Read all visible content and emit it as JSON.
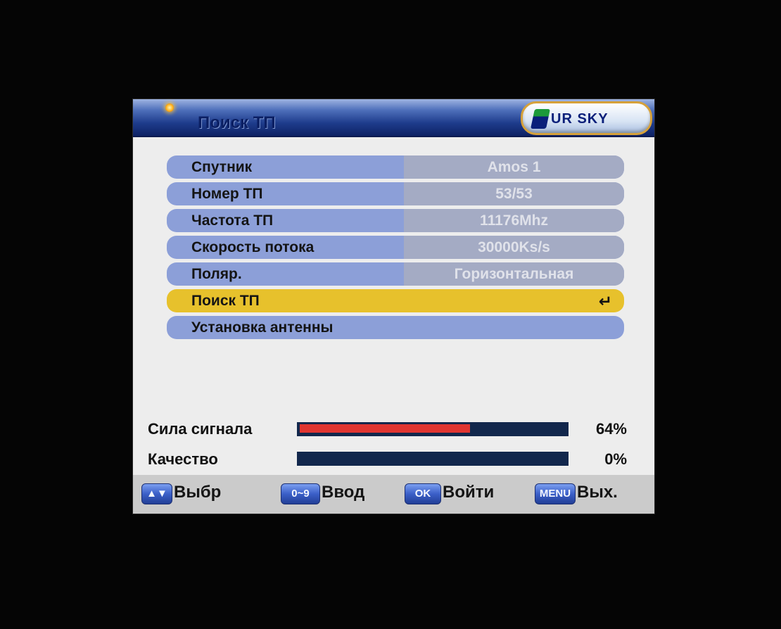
{
  "title": "Поиск ТП",
  "logo": {
    "text": "UR SKY"
  },
  "menu": [
    {
      "label": "Спутник",
      "value": "Amos 1"
    },
    {
      "label": "Номер ТП",
      "value": "53/53"
    },
    {
      "label": "Частота ТП",
      "value": "11176Mhz"
    },
    {
      "label": "Скорость потока",
      "value": "30000Ks/s"
    },
    {
      "label": "Поляр.",
      "value": "Горизонтальная"
    },
    {
      "label": "Поиск ТП",
      "enter_icon": "↵",
      "selected": true
    },
    {
      "label": "Установка антенны"
    }
  ],
  "signal": {
    "strength_label": "Сила сигнала",
    "strength_pct": "64%",
    "strength_value": 0.64,
    "quality_label": "Качество",
    "quality_pct": "0%",
    "quality_value": 0
  },
  "help": [
    {
      "key": "▲▼",
      "label": "Выбр"
    },
    {
      "key": "0~9",
      "label": "Ввод"
    },
    {
      "key": "OK",
      "label": "Войти"
    },
    {
      "key": "MENU",
      "label": "Вых."
    }
  ],
  "colors": {
    "selected_row": "#e7c12c",
    "row": "#8c9fd8",
    "value_cell": "#a4abc4",
    "signal_fill": "#e03531",
    "meter_bg": "#12274c"
  }
}
